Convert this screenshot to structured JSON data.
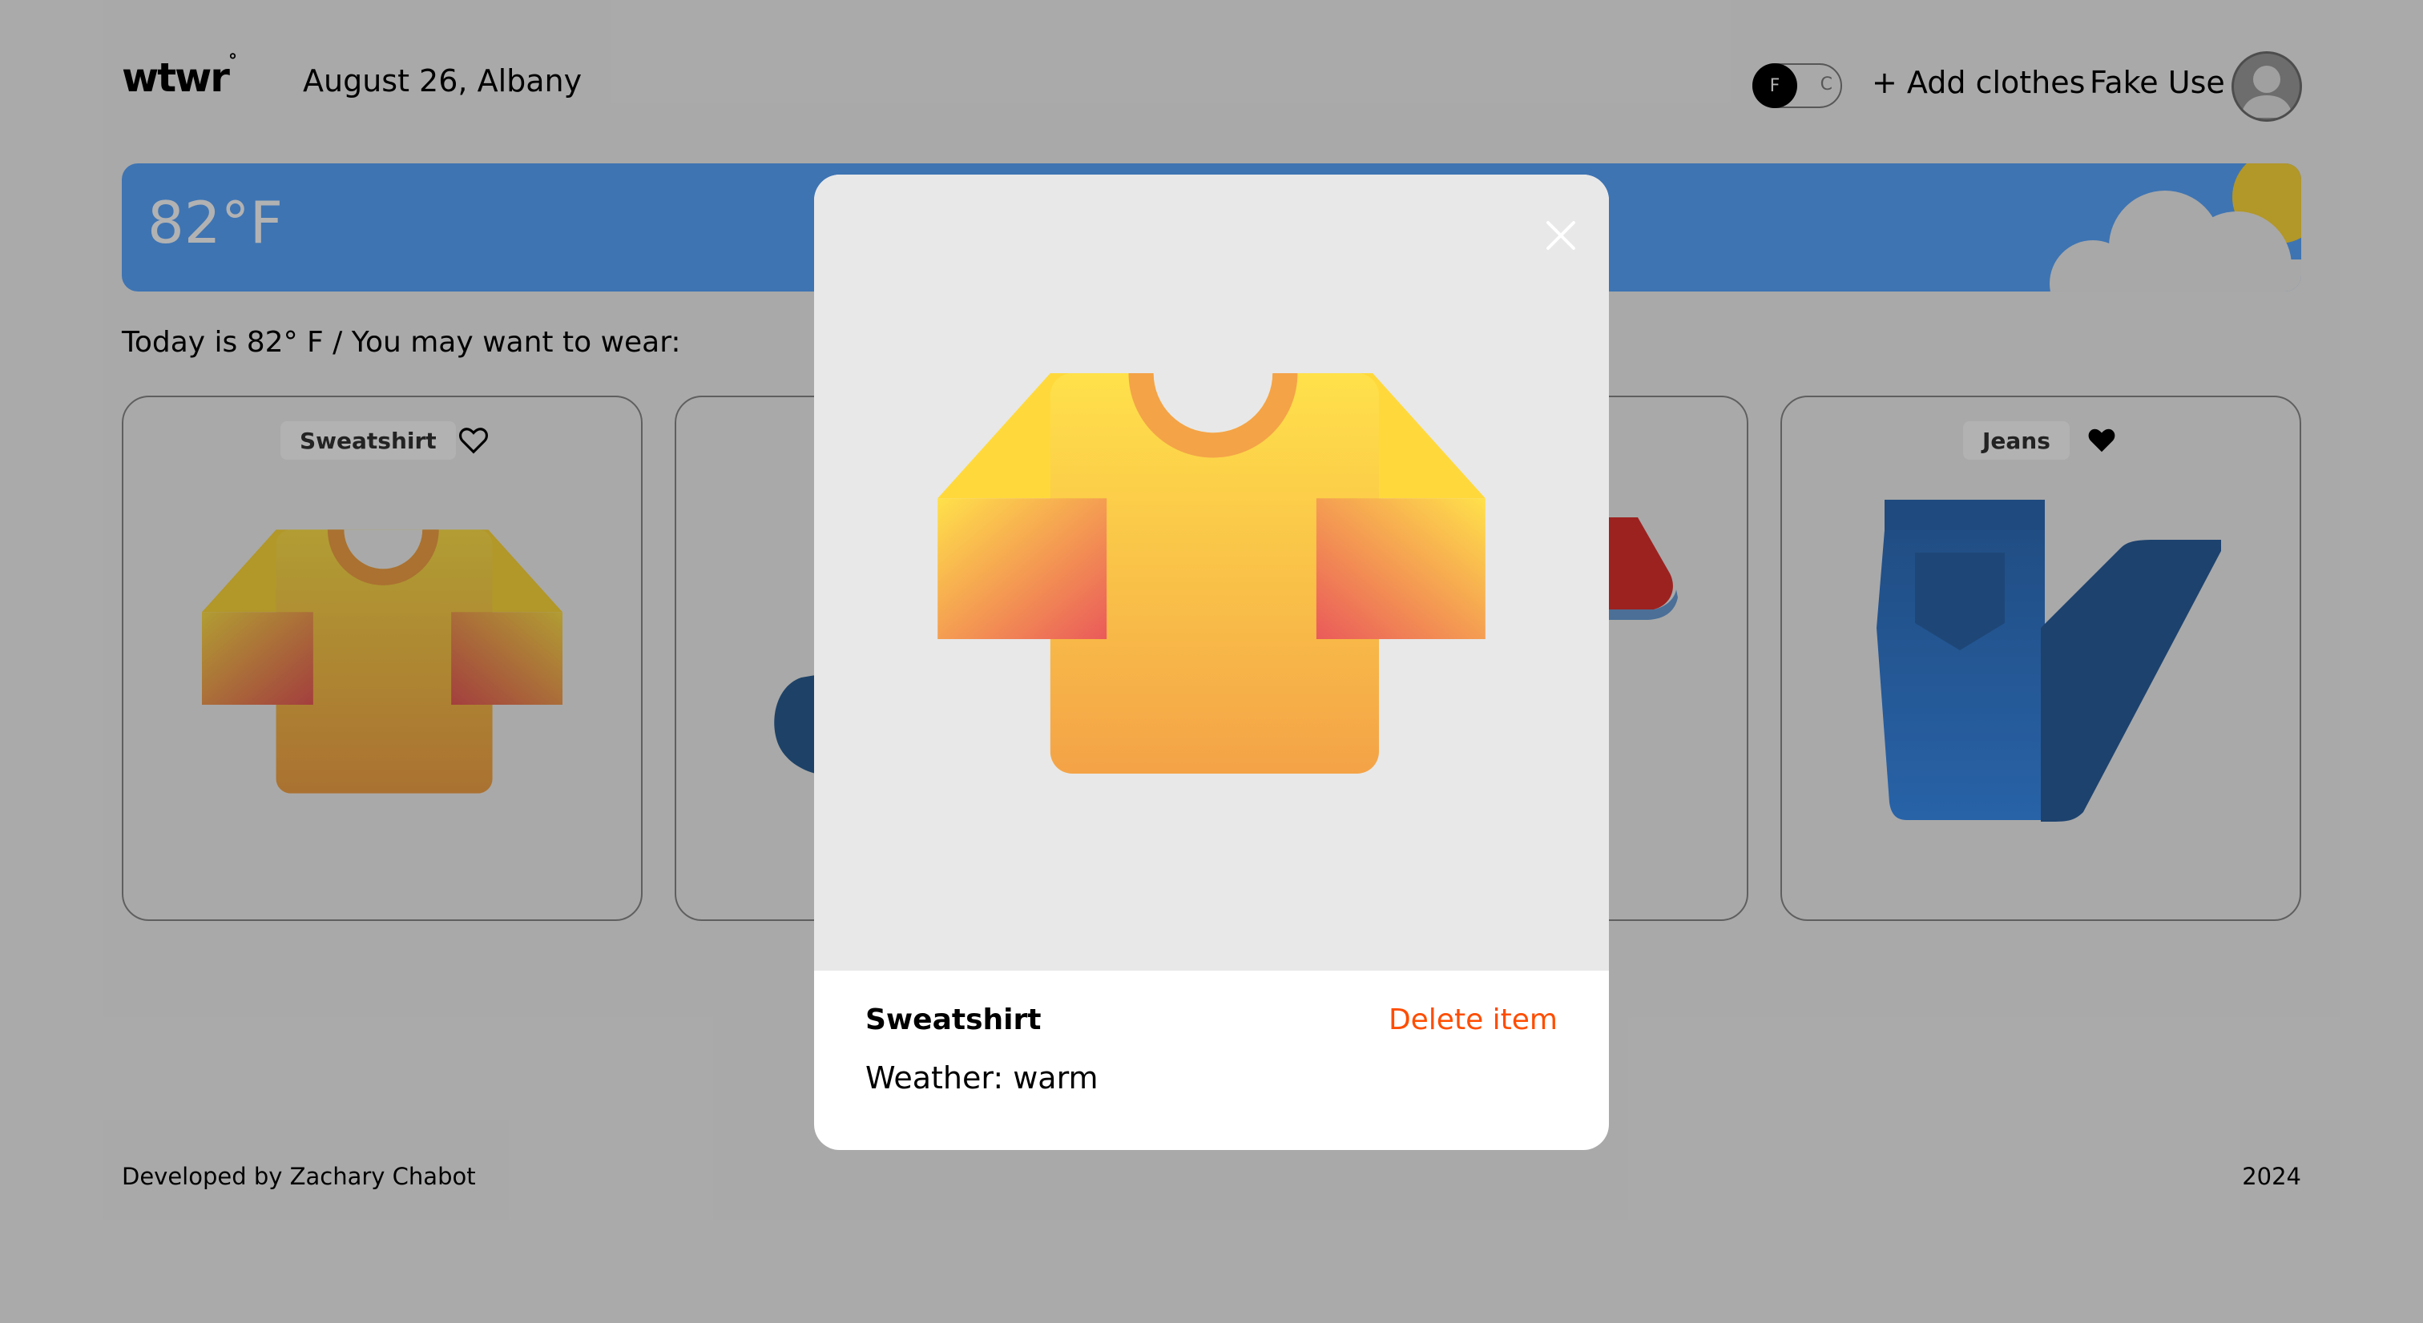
{
  "header": {
    "logo": "wtwr",
    "logo_mark": "°",
    "date_location": "August 26, Albany",
    "unit_toggle": {
      "on": "F",
      "off": "C"
    },
    "add_clothes": "+ Add clothes",
    "username": "Fake Use"
  },
  "weather": {
    "temperature": "82°F",
    "recommendation": "Today is 82° F / You may want to wear:"
  },
  "cards": [
    {
      "label": "Sweatshirt",
      "liked": false
    },
    {
      "label": "Jeans",
      "liked": true
    }
  ],
  "footer": {
    "credit": "Developed by Zachary Chabot",
    "year": "2024"
  },
  "modal": {
    "title": "Sweatshirt",
    "delete_label": "Delete item",
    "weather_text": "Weather: warm"
  },
  "icons": [
    "close-icon",
    "heart-outline-icon",
    "heart-filled-icon",
    "avatar-icon",
    "sun-cloud-icon"
  ],
  "colors": {
    "weather_card": "#5aa6ff",
    "delete": "#ff4d00",
    "modal_image_bg": "#e8e8e8"
  }
}
